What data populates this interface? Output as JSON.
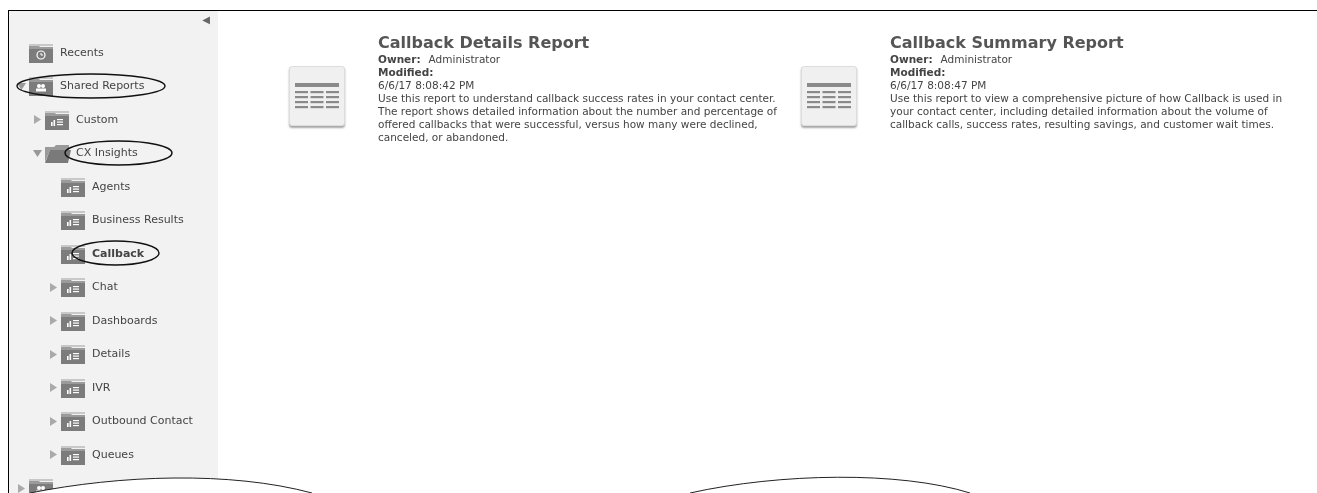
{
  "sidebar": {
    "collapse_button": "◀",
    "tree": [
      {
        "kind": "recents",
        "label": "Recents"
      },
      {
        "kind": "shared",
        "label": "Shared Reports",
        "expanded": true,
        "circled": true,
        "children": [
          {
            "kind": "folder",
            "label": "Custom",
            "expanded": false
          },
          {
            "kind": "folder",
            "label": "CX Insights",
            "expanded": true,
            "circled": true,
            "children": [
              {
                "kind": "folder",
                "label": "Agents",
                "selected": false
              },
              {
                "kind": "folder",
                "label": "Business Results",
                "selected": false
              },
              {
                "kind": "folder",
                "label": "Callback",
                "selected": true,
                "circled": true
              },
              {
                "kind": "folder",
                "label": "Chat",
                "expanded": false,
                "selected": false
              },
              {
                "kind": "folder",
                "label": "Dashboards",
                "expanded": false,
                "selected": false
              },
              {
                "kind": "folder",
                "label": "Details",
                "expanded": false,
                "selected": false
              },
              {
                "kind": "folder",
                "label": "IVR",
                "expanded": false,
                "selected": false
              },
              {
                "kind": "folder",
                "label": "Outbound Contact",
                "expanded": false,
                "selected": false
              },
              {
                "kind": "folder",
                "label": "Queues",
                "expanded": false,
                "selected": false
              }
            ]
          }
        ]
      },
      {
        "kind": "shared",
        "expanded": false
      }
    ]
  },
  "reports": [
    {
      "title": "Callback Details Report",
      "owner_label": "Owner:",
      "owner": "Administrator",
      "modified_label": "Modified:",
      "modified": "6/6/17 8:08:42 PM",
      "description": "Use this report to understand callback success rates in your contact center. The report shows detailed information about the number and percentage of offered callbacks that were successful, versus how many were declined, canceled, or abandoned."
    },
    {
      "title": "Callback Summary Report",
      "owner_label": "Owner:",
      "owner": "Administrator",
      "modified_label": "Modified:",
      "modified": "6/6/17 8:08:47 PM",
      "description": "Use this report to view a comprehensive picture of how Callback is used in your contact center, including detailed information about the volume of callback calls, success rates, resulting savings, and customer wait times."
    }
  ]
}
